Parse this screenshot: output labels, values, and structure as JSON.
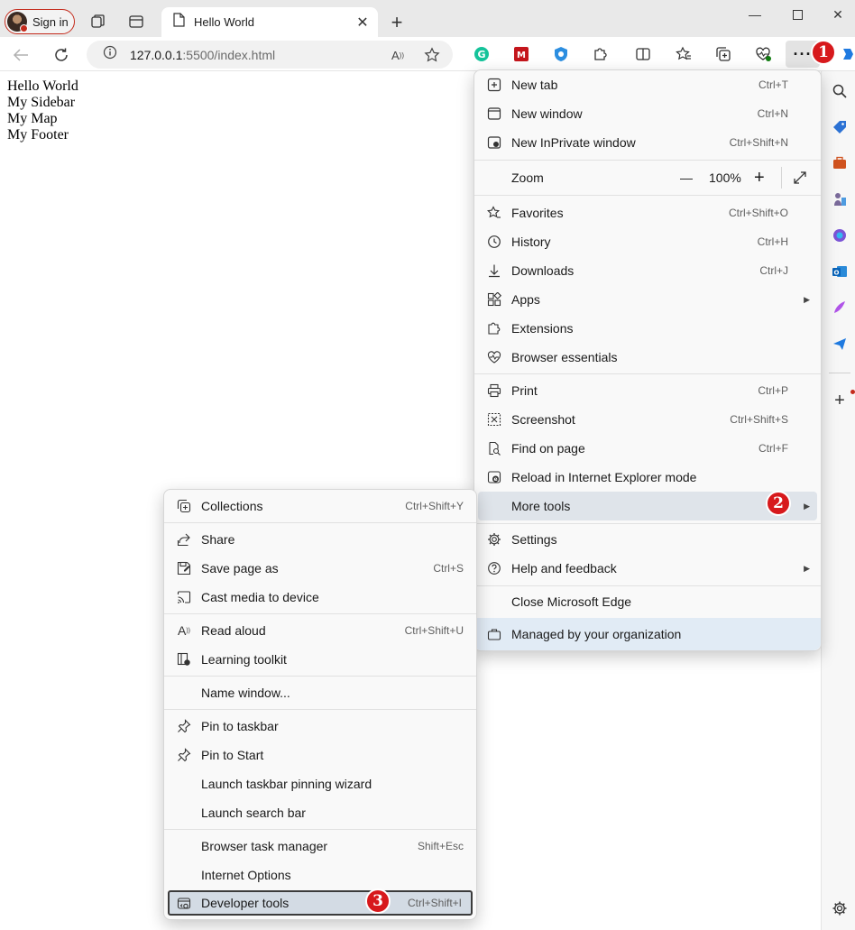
{
  "browser": {
    "profile_label": "Sign in",
    "tab_title": "Hello World",
    "url_host": "127.0.0.1",
    "url_rest": ":5500/index.html"
  },
  "page": {
    "lines": [
      "Hello World",
      "My Sidebar",
      "My Map",
      "My Footer"
    ]
  },
  "main_menu": {
    "items": [
      {
        "label": "New tab",
        "shortcut": "Ctrl+T",
        "icon": "new-tab-icon"
      },
      {
        "label": "New window",
        "shortcut": "Ctrl+N",
        "icon": "new-window-icon"
      },
      {
        "label": "New InPrivate window",
        "shortcut": "Ctrl+Shift+N",
        "icon": "inprivate-icon"
      },
      {
        "label": "Zoom",
        "value": "100%",
        "minus": "—",
        "plus": "+"
      },
      {
        "label": "Favorites",
        "shortcut": "Ctrl+Shift+O",
        "icon": "favorites-icon"
      },
      {
        "label": "History",
        "shortcut": "Ctrl+H",
        "icon": "history-icon"
      },
      {
        "label": "Downloads",
        "shortcut": "Ctrl+J",
        "icon": "downloads-icon"
      },
      {
        "label": "Apps",
        "shortcut": "",
        "icon": "apps-icon"
      },
      {
        "label": "Extensions",
        "shortcut": "",
        "icon": "extensions-icon"
      },
      {
        "label": "Browser essentials",
        "shortcut": "",
        "icon": "heart-pulse-icon"
      },
      {
        "label": "Print",
        "shortcut": "Ctrl+P",
        "icon": "print-icon"
      },
      {
        "label": "Screenshot",
        "shortcut": "Ctrl+Shift+S",
        "icon": "screenshot-icon"
      },
      {
        "label": "Find on page",
        "shortcut": "Ctrl+F",
        "icon": "find-icon"
      },
      {
        "label": "Reload in Internet Explorer mode",
        "shortcut": "",
        "icon": "ie-mode-icon"
      },
      {
        "label": "More tools",
        "shortcut": "",
        "icon": ""
      },
      {
        "label": "Settings",
        "shortcut": "",
        "icon": "gear-icon"
      },
      {
        "label": "Help and feedback",
        "shortcut": "",
        "icon": "help-icon"
      },
      {
        "label": "Close Microsoft Edge",
        "shortcut": "",
        "icon": ""
      },
      {
        "label": "Managed by your organization",
        "shortcut": "",
        "icon": "briefcase-icon"
      }
    ]
  },
  "sub_menu": {
    "items": [
      {
        "label": "Collections",
        "shortcut": "Ctrl+Shift+Y",
        "icon": "collections-icon"
      },
      {
        "label": "Share",
        "shortcut": "",
        "icon": "share-icon"
      },
      {
        "label": "Save page as",
        "shortcut": "Ctrl+S",
        "icon": "save-icon"
      },
      {
        "label": "Cast media to device",
        "shortcut": "",
        "icon": "cast-icon"
      },
      {
        "label": "Read aloud",
        "shortcut": "Ctrl+Shift+U",
        "icon": "read-aloud-icon"
      },
      {
        "label": "Learning toolkit",
        "shortcut": "",
        "icon": "learning-icon"
      },
      {
        "label": "Name window...",
        "shortcut": "",
        "icon": ""
      },
      {
        "label": "Pin to taskbar",
        "shortcut": "",
        "icon": "pin-icon"
      },
      {
        "label": "Pin to Start",
        "shortcut": "",
        "icon": "pin-icon"
      },
      {
        "label": "Launch taskbar pinning wizard",
        "shortcut": "",
        "icon": ""
      },
      {
        "label": "Launch search bar",
        "shortcut": "",
        "icon": ""
      },
      {
        "label": "Browser task manager",
        "shortcut": "Shift+Esc",
        "icon": ""
      },
      {
        "label": "Internet Options",
        "shortcut": "",
        "icon": ""
      },
      {
        "label": "Developer tools",
        "shortcut": "Ctrl+Shift+I",
        "icon": "devtools-icon"
      }
    ]
  },
  "badges": [
    "1",
    "2",
    "3"
  ],
  "colors": {
    "badge": "#d7191c",
    "accent": "#0067c0"
  }
}
